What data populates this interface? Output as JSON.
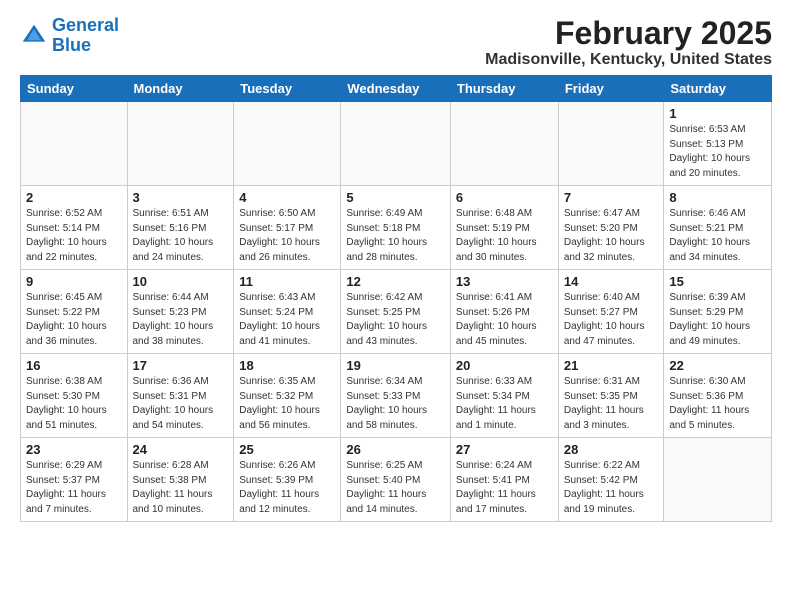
{
  "logo": {
    "line1": "General",
    "line2": "Blue"
  },
  "title": "February 2025",
  "subtitle": "Madisonville, Kentucky, United States",
  "days_header": [
    "Sunday",
    "Monday",
    "Tuesday",
    "Wednesday",
    "Thursday",
    "Friday",
    "Saturday"
  ],
  "weeks": [
    [
      {
        "day": "",
        "info": ""
      },
      {
        "day": "",
        "info": ""
      },
      {
        "day": "",
        "info": ""
      },
      {
        "day": "",
        "info": ""
      },
      {
        "day": "",
        "info": ""
      },
      {
        "day": "",
        "info": ""
      },
      {
        "day": "1",
        "info": "Sunrise: 6:53 AM\nSunset: 5:13 PM\nDaylight: 10 hours and 20 minutes."
      }
    ],
    [
      {
        "day": "2",
        "info": "Sunrise: 6:52 AM\nSunset: 5:14 PM\nDaylight: 10 hours and 22 minutes."
      },
      {
        "day": "3",
        "info": "Sunrise: 6:51 AM\nSunset: 5:16 PM\nDaylight: 10 hours and 24 minutes."
      },
      {
        "day": "4",
        "info": "Sunrise: 6:50 AM\nSunset: 5:17 PM\nDaylight: 10 hours and 26 minutes."
      },
      {
        "day": "5",
        "info": "Sunrise: 6:49 AM\nSunset: 5:18 PM\nDaylight: 10 hours and 28 minutes."
      },
      {
        "day": "6",
        "info": "Sunrise: 6:48 AM\nSunset: 5:19 PM\nDaylight: 10 hours and 30 minutes."
      },
      {
        "day": "7",
        "info": "Sunrise: 6:47 AM\nSunset: 5:20 PM\nDaylight: 10 hours and 32 minutes."
      },
      {
        "day": "8",
        "info": "Sunrise: 6:46 AM\nSunset: 5:21 PM\nDaylight: 10 hours and 34 minutes."
      }
    ],
    [
      {
        "day": "9",
        "info": "Sunrise: 6:45 AM\nSunset: 5:22 PM\nDaylight: 10 hours and 36 minutes."
      },
      {
        "day": "10",
        "info": "Sunrise: 6:44 AM\nSunset: 5:23 PM\nDaylight: 10 hours and 38 minutes."
      },
      {
        "day": "11",
        "info": "Sunrise: 6:43 AM\nSunset: 5:24 PM\nDaylight: 10 hours and 41 minutes."
      },
      {
        "day": "12",
        "info": "Sunrise: 6:42 AM\nSunset: 5:25 PM\nDaylight: 10 hours and 43 minutes."
      },
      {
        "day": "13",
        "info": "Sunrise: 6:41 AM\nSunset: 5:26 PM\nDaylight: 10 hours and 45 minutes."
      },
      {
        "day": "14",
        "info": "Sunrise: 6:40 AM\nSunset: 5:27 PM\nDaylight: 10 hours and 47 minutes."
      },
      {
        "day": "15",
        "info": "Sunrise: 6:39 AM\nSunset: 5:29 PM\nDaylight: 10 hours and 49 minutes."
      }
    ],
    [
      {
        "day": "16",
        "info": "Sunrise: 6:38 AM\nSunset: 5:30 PM\nDaylight: 10 hours and 51 minutes."
      },
      {
        "day": "17",
        "info": "Sunrise: 6:36 AM\nSunset: 5:31 PM\nDaylight: 10 hours and 54 minutes."
      },
      {
        "day": "18",
        "info": "Sunrise: 6:35 AM\nSunset: 5:32 PM\nDaylight: 10 hours and 56 minutes."
      },
      {
        "day": "19",
        "info": "Sunrise: 6:34 AM\nSunset: 5:33 PM\nDaylight: 10 hours and 58 minutes."
      },
      {
        "day": "20",
        "info": "Sunrise: 6:33 AM\nSunset: 5:34 PM\nDaylight: 11 hours and 1 minute."
      },
      {
        "day": "21",
        "info": "Sunrise: 6:31 AM\nSunset: 5:35 PM\nDaylight: 11 hours and 3 minutes."
      },
      {
        "day": "22",
        "info": "Sunrise: 6:30 AM\nSunset: 5:36 PM\nDaylight: 11 hours and 5 minutes."
      }
    ],
    [
      {
        "day": "23",
        "info": "Sunrise: 6:29 AM\nSunset: 5:37 PM\nDaylight: 11 hours and 7 minutes."
      },
      {
        "day": "24",
        "info": "Sunrise: 6:28 AM\nSunset: 5:38 PM\nDaylight: 11 hours and 10 minutes."
      },
      {
        "day": "25",
        "info": "Sunrise: 6:26 AM\nSunset: 5:39 PM\nDaylight: 11 hours and 12 minutes."
      },
      {
        "day": "26",
        "info": "Sunrise: 6:25 AM\nSunset: 5:40 PM\nDaylight: 11 hours and 14 minutes."
      },
      {
        "day": "27",
        "info": "Sunrise: 6:24 AM\nSunset: 5:41 PM\nDaylight: 11 hours and 17 minutes."
      },
      {
        "day": "28",
        "info": "Sunrise: 6:22 AM\nSunset: 5:42 PM\nDaylight: 11 hours and 19 minutes."
      },
      {
        "day": "",
        "info": ""
      }
    ]
  ]
}
